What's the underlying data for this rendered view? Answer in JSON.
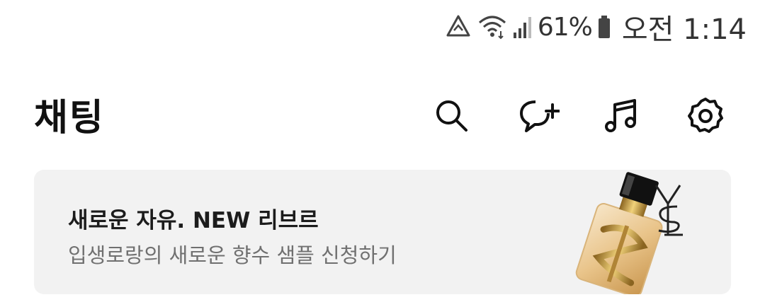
{
  "status_bar": {
    "icons": [
      "data-saver-icon",
      "wifi-icon",
      "signal-icon",
      "battery-icon"
    ],
    "battery_percent": "61%",
    "time": "오전 1:14"
  },
  "header": {
    "title": "채팅",
    "actions": [
      "search-icon",
      "new-chat-icon",
      "music-icon",
      "settings-icon"
    ]
  },
  "banner": {
    "title": "새로운 자유. NEW 리브르",
    "subtitle": "입생로랑의 새로운 향수 샘플 신청하기",
    "image": "perfume-bottle-image",
    "logo": "ysl-logo"
  },
  "colors": {
    "banner_bg": "#f2f2f2",
    "title_text": "#111111",
    "subtitle_text": "#707070"
  }
}
